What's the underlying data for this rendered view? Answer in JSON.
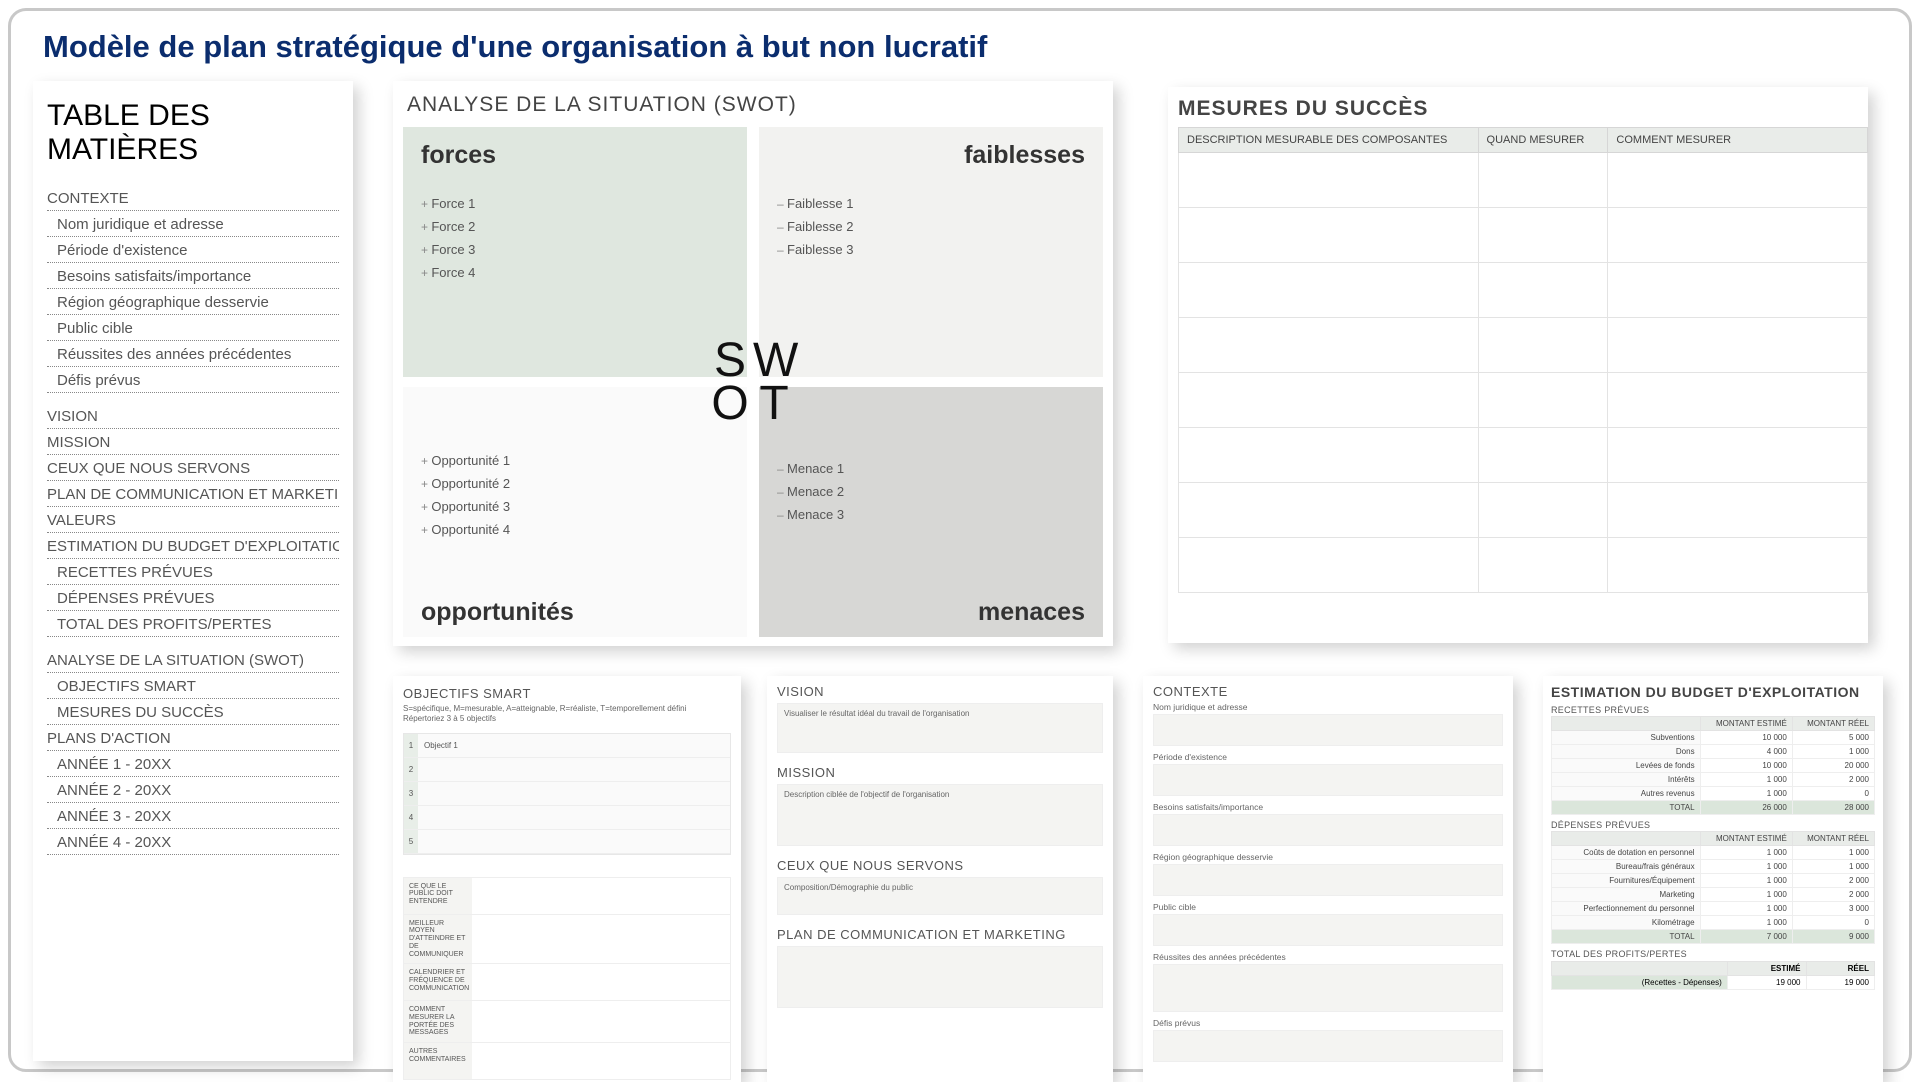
{
  "title": "Modèle de plan stratégique d'une organisation à but non lucratif",
  "toc": {
    "heading": "TABLE DES MATIÈRES",
    "lines": [
      {
        "t": "CONTEXTE",
        "sub": false
      },
      {
        "t": "Nom juridique et adresse",
        "sub": true
      },
      {
        "t": "Période d'existence",
        "sub": true
      },
      {
        "t": "Besoins satisfaits/importance",
        "sub": true
      },
      {
        "t": "Région géographique desservie",
        "sub": true
      },
      {
        "t": "Public cible",
        "sub": true
      },
      {
        "t": "Réussites des années précédentes",
        "sub": true
      },
      {
        "t": "Défis prévus",
        "sub": true
      },
      {
        "gap": true
      },
      {
        "t": "VISION",
        "sub": false
      },
      {
        "t": "MISSION",
        "sub": false
      },
      {
        "t": "CEUX QUE NOUS SERVONS",
        "sub": false
      },
      {
        "t": "PLAN DE COMMUNICATION ET MARKETING",
        "sub": false
      },
      {
        "t": "VALEURS",
        "sub": false
      },
      {
        "t": "ESTIMATION DU BUDGET D'EXPLOITATION",
        "sub": false
      },
      {
        "t": "RECETTES PRÉVUES",
        "sub": true
      },
      {
        "t": "DÉPENSES PRÉVUES",
        "sub": true
      },
      {
        "t": "TOTAL DES PROFITS/PERTES",
        "sub": true
      },
      {
        "gap": true
      },
      {
        "t": "ANALYSE DE LA SITUATION (SWOT)",
        "sub": false
      },
      {
        "t": "OBJECTIFS SMART",
        "sub": true
      },
      {
        "t": "MESURES DU SUCCÈS",
        "sub": true
      },
      {
        "t": "PLANS D'ACTION",
        "sub": false
      },
      {
        "t": "ANNÉE 1 - 20XX",
        "sub": true
      },
      {
        "t": "ANNÉE 2 - 20XX",
        "sub": true
      },
      {
        "t": "ANNÉE 3 - 20XX",
        "sub": true
      },
      {
        "t": "ANNÉE 4 - 20XX",
        "sub": true
      }
    ]
  },
  "swot": {
    "title": "ANALYSE DE LA SITUATION (SWOT)",
    "s": {
      "h": "forces",
      "items": [
        "Force 1",
        "Force 2",
        "Force 3",
        "Force 4"
      ],
      "bullet": "+"
    },
    "w": {
      "h": "faiblesses",
      "items": [
        "Faiblesse 1",
        "Faiblesse 2",
        "Faiblesse 3"
      ],
      "bullet": "–"
    },
    "o": {
      "h": "opportunités",
      "items": [
        "Opportunité 1",
        "Opportunité 2",
        "Opportunité 3",
        "Opportunité 4"
      ],
      "bullet": "+"
    },
    "t": {
      "h": "menaces",
      "items": [
        "Menace 1",
        "Menace 2",
        "Menace 3"
      ],
      "bullet": "–"
    },
    "letters": [
      "S",
      "W",
      "O",
      "T"
    ]
  },
  "measures": {
    "title": "MESURES DU SUCCÈS",
    "cols": [
      "DESCRIPTION MESURABLE DES COMPOSANTES",
      "QUAND MESURER",
      "COMMENT MESURER"
    ],
    "rows": 8
  },
  "smart": {
    "title": "OBJECTIFS SMART",
    "sub1": "S=spécifique, M=mesurable, A=atteignable, R=réaliste, T=temporellement défini",
    "sub2": "Répertoriez 3 à 5 objectifs",
    "rows": [
      {
        "n": "1",
        "t": "Objectif 1"
      },
      {
        "n": "2",
        "t": ""
      },
      {
        "n": "3",
        "t": ""
      },
      {
        "n": "4",
        "t": ""
      },
      {
        "n": "5",
        "t": ""
      }
    ],
    "lower": [
      "CE QUE LE PUBLIC DOIT ENTENDRE",
      "MEILLEUR MOYEN D'ATTEINDRE ET DE COMMUNIQUER",
      "CALENDRIER ET FRÉQUENCE DE COMMUNICATION",
      "COMMENT MESURER LA PORTÉE DES MESSAGES",
      "AUTRES COMMENTAIRES"
    ]
  },
  "vm": {
    "vision": {
      "h": "VISION",
      "ph": "Visualiser le résultat idéal du travail de l'organisation"
    },
    "mission": {
      "h": "MISSION",
      "ph": "Description ciblée de l'objectif de l'organisation"
    },
    "serve": {
      "h": "CEUX QUE NOUS SERVONS",
      "ph": "Composition/Démographie du public"
    },
    "comm": {
      "h": "PLAN DE COMMUNICATION ET MARKETING",
      "ph": ""
    }
  },
  "ctx": {
    "title": "CONTEXTE",
    "fields": [
      "Nom juridique et adresse",
      "Période d'existence",
      "Besoins satisfaits/importance",
      "Région géographique desservie",
      "Public cible",
      "Réussites des années précédentes",
      "Défis prévus"
    ]
  },
  "budget": {
    "title": "ESTIMATION DU BUDGET D'EXPLOITATION",
    "rev": {
      "h": "RECETTES PRÉVUES",
      "cols": [
        "",
        "MONTANT ESTIMÉ",
        "MONTANT RÉEL"
      ],
      "rows": [
        [
          "Subventions",
          "10 000",
          "5 000"
        ],
        [
          "Dons",
          "4 000",
          "1 000"
        ],
        [
          "Levées de fonds",
          "10 000",
          "20 000"
        ],
        [
          "Intérêts",
          "1 000",
          "2 000"
        ],
        [
          "Autres revenus",
          "1 000",
          "0"
        ]
      ],
      "total": [
        "TOTAL",
        "26 000",
        "28 000"
      ]
    },
    "exp": {
      "h": "DÉPENSES PRÉVUES",
      "cols": [
        "",
        "MONTANT ESTIMÉ",
        "MONTANT RÉEL"
      ],
      "rows": [
        [
          "Coûts de dotation en personnel",
          "1 000",
          "1 000"
        ],
        [
          "Bureau/frais généraux",
          "1 000",
          "1 000"
        ],
        [
          "Fournitures/Équipement",
          "1 000",
          "2 000"
        ],
        [
          "Marketing",
          "1 000",
          "2 000"
        ],
        [
          "Perfectionnement du personnel",
          "1 000",
          "3 000"
        ],
        [
          "Kilométrage",
          "1 000",
          "0"
        ]
      ],
      "total": [
        "TOTAL",
        "7 000",
        "9 000"
      ]
    },
    "pl": {
      "h": "TOTAL DES PROFITS/PERTES",
      "cols": [
        "",
        "ESTIMÉ",
        "RÉEL"
      ],
      "row": [
        "(Recettes - Dépenses)",
        "19 000",
        "19 000"
      ]
    }
  }
}
